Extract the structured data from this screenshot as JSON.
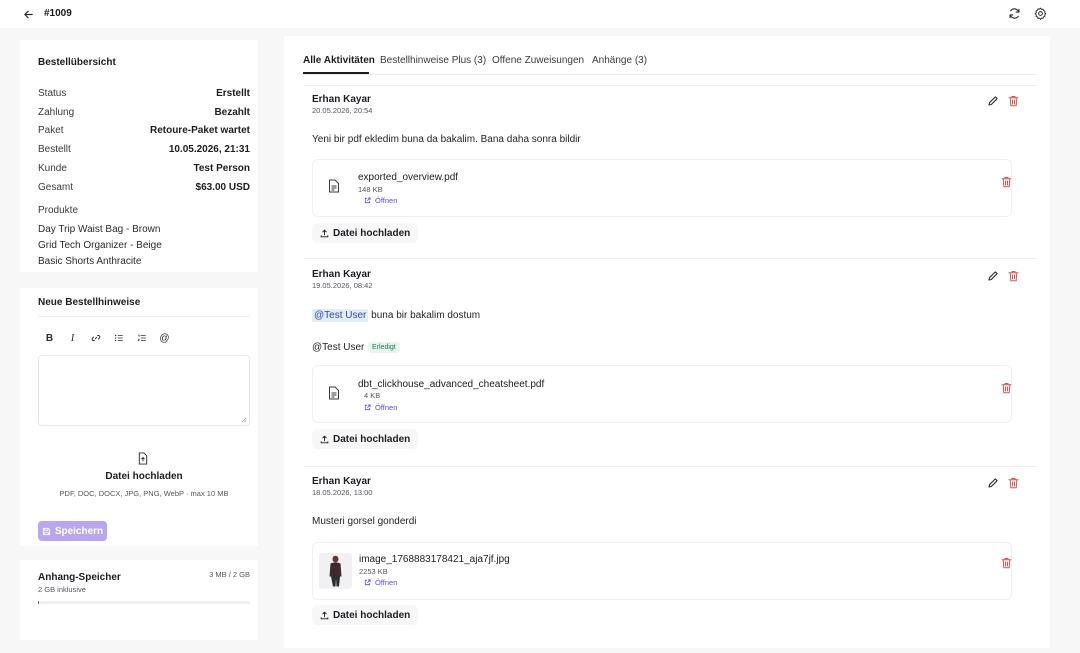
{
  "header": {
    "order_id": "#1009"
  },
  "summary": {
    "title": "Bestellübersicht",
    "rows": [
      {
        "label": "Status",
        "value": "Erstellt"
      },
      {
        "label": "Zahlung",
        "value": "Bezahlt"
      },
      {
        "label": "Paket",
        "value": "Retoure-Paket wartet"
      },
      {
        "label": "Bestellt",
        "value": "10.05.2026, 21:31"
      },
      {
        "label": "Kunde",
        "value": "Test Person"
      },
      {
        "label": "Gesamt",
        "value": "$63.00 USD"
      }
    ],
    "products_label": "Produkte",
    "products": [
      "Day Trip Waist Bag - Brown",
      "Grid Tech Organizer - Beige",
      "Basic Shorts Anthracite"
    ]
  },
  "notes": {
    "title": "Neue Bestellhinweise",
    "toolbar": [
      "B",
      "I",
      "link",
      "bullet-list",
      "numbered-list",
      "@"
    ],
    "upload_title": "Datei hochladen",
    "upload_hint": "PDF, DOC, DOCX, JPG, PNG, WebP · max 10 MB",
    "save_label": "Speichern"
  },
  "storage": {
    "title": "Anhang-Speicher",
    "subtitle": "2 GB inklusive",
    "usage": "3 MB / 2 GB",
    "used_fraction": 0.0015
  },
  "tabs": [
    {
      "label": "Alle Aktivitäten",
      "active": true
    },
    {
      "label": "Bestellhinweise Plus (3)",
      "active": false
    },
    {
      "label": "Offene Zuweisungen",
      "active": false
    },
    {
      "label": "Anhänge (3)",
      "active": false
    }
  ],
  "activities": [
    {
      "author": "Erhan Kayar",
      "date": "20.05.2026, 20:54",
      "message": "Yeni bir pdf ekledim buna da bakalim. Bana daha sonra bildir",
      "file": {
        "name": "exported_overview.pdf",
        "size": "148 KB",
        "open": "Öffnen"
      },
      "upload_label": "Datei hochladen"
    },
    {
      "author": "Erhan Kayar",
      "date": "19.05.2026, 08:42",
      "mention": "@Test User",
      "message": "buna bir bakalim dostum",
      "assignee": "@Test User",
      "badge": "Erledigt",
      "file": {
        "name": "dbt_clickhouse_advanced_cheatsheet.pdf",
        "size": "4 KB",
        "open": "Öffnen"
      },
      "upload_label": "Datei hochladen"
    },
    {
      "author": "Erhan Kayar",
      "date": "18.05.2026, 13:00",
      "message": "Musteri gorsel gonderdi",
      "file": {
        "name": "image_1768883178421_aja7jf.jpg",
        "size": "2253 KB",
        "open": "Öffnen"
      },
      "upload_label": "Datei hochladen"
    }
  ],
  "colors": {
    "accent": "#5b4fd6",
    "danger": "#e0504a",
    "save_disabled": "#b9a6ef",
    "success": "#1e7a45"
  }
}
